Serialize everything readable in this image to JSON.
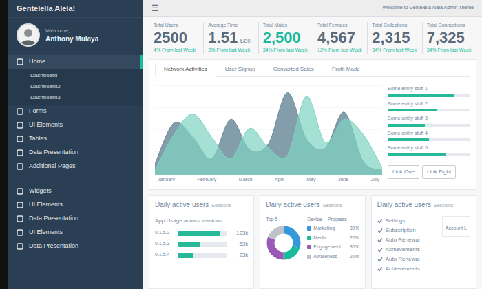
{
  "sidebar": {
    "brand": "Gentelella Alela!",
    "welcome": "Welcome,",
    "user": "Anthony Mulaya",
    "sections": [
      {
        "items": [
          {
            "label": "Home",
            "expanded": true,
            "selected": true,
            "children": [
              "Dashboard",
              "Dashboard2",
              "Dashboard3"
            ]
          },
          {
            "label": "Forms",
            "expanded": false,
            "selected": false,
            "children": []
          },
          {
            "label": "UI Elements",
            "expanded": false,
            "selected": false,
            "children": []
          },
          {
            "label": "Tables",
            "expanded": false,
            "selected": false,
            "children": []
          },
          {
            "label": "Data Presentation",
            "expanded": false,
            "selected": false,
            "children": []
          },
          {
            "label": "Additional Pages",
            "expanded": false,
            "selected": false,
            "children": []
          }
        ]
      },
      {
        "items": [
          {
            "label": "Widgets",
            "expanded": false,
            "selected": false,
            "children": []
          },
          {
            "label": "UI Elements",
            "expanded": false,
            "selected": false,
            "children": []
          },
          {
            "label": "Data Presentation",
            "expanded": false,
            "selected": false,
            "children": []
          },
          {
            "label": "UI Elements",
            "expanded": false,
            "selected": false,
            "children": []
          },
          {
            "label": "Data Presentation",
            "expanded": false,
            "selected": false,
            "children": []
          }
        ]
      }
    ]
  },
  "topbar": {
    "menu_icon": "☰",
    "notice": "Welcome to Gentelella Alela Admin Theme"
  },
  "stats": [
    {
      "label": "Total Users",
      "value": "2500",
      "change": "4% From last Week",
      "color": "#5A6A7A"
    },
    {
      "label": "Average Time",
      "value": "1.51",
      "unit": "Sec",
      "change": "3% From last Week",
      "color": "#5A6A7A"
    },
    {
      "label": "Total Males",
      "value": "2,500",
      "change": "34% From last Week",
      "color": "#1ABB9C"
    },
    {
      "label": "Total Females",
      "value": "4,567",
      "change": "12% From last Week",
      "color": "#5A6A7A"
    },
    {
      "label": "Total Collections",
      "value": "2,315",
      "change": "34% From last Week",
      "color": "#5A6A7A"
    },
    {
      "label": "Total Connections",
      "value": "7,325",
      "change": "34% From last Week",
      "color": "#5A6A7A"
    }
  ],
  "tabs": [
    {
      "label": "Network Activities",
      "selected": true
    },
    {
      "label": "User Signup",
      "selected": false
    },
    {
      "label": "Converted Sales",
      "selected": false
    },
    {
      "label": "Profit Made",
      "selected": false
    }
  ],
  "chart": {
    "x_labels": [
      "January",
      "February",
      "March",
      "April",
      "May",
      "June",
      "July"
    ],
    "series": [
      {
        "values": [
          12,
          58,
          42,
          18,
          62,
          28,
          35,
          92,
          40,
          30,
          70,
          15,
          5
        ],
        "color": "#6F8C9B"
      },
      {
        "values": [
          5,
          45,
          68,
          42,
          18,
          52,
          30,
          22,
          88,
          36,
          62,
          45,
          8
        ],
        "color": "#7ED3C1"
      }
    ]
  },
  "progress": [
    {
      "label": "Some entity stuff 1",
      "level": 0.8
    },
    {
      "label": "Some entity stuff 2",
      "level": 0.6
    },
    {
      "label": "Some entity stuff 3",
      "level": 0.45
    },
    {
      "label": "Some entity stuff 4",
      "level": 0.5
    },
    {
      "label": "Some entity stuff 5",
      "level": 0.7
    }
  ],
  "chart_buttons": [
    "Link One",
    "Link Eight"
  ],
  "sessions_card": {
    "title": "Daily active users",
    "subtitle": "Sessions",
    "heading": "App Usage across versions",
    "rows": [
      {
        "label": "0.1.5.2",
        "level": 0.85,
        "value": "123k"
      },
      {
        "label": "0.1.5.3",
        "level": 0.45,
        "value": "53k"
      },
      {
        "label": "0.1.5.4",
        "level": 0.3,
        "value": "23k"
      }
    ]
  },
  "devices_card": {
    "title": "Daily active users",
    "subtitle": "Sessions",
    "headers": [
      "Top 5",
      "Device",
      "Progress"
    ],
    "legend": [
      {
        "label": "Marketing",
        "value": "30%",
        "share": 30,
        "color": "#3498DB"
      },
      {
        "label": "Media",
        "value": "20%",
        "share": 20,
        "color": "#1ABB9C"
      },
      {
        "label": "Engagement",
        "value": "30%",
        "share": 30,
        "color": "#9B59B6"
      },
      {
        "label": "Awareness",
        "value": "20%",
        "share": 20,
        "color": "#BDC3C7"
      }
    ]
  },
  "settings_card": {
    "title": "Daily active users",
    "subtitle": "Sessions",
    "side_label": "Account L",
    "items": [
      {
        "label": "Settings",
        "checked": true
      },
      {
        "label": "Subscription",
        "checked": true
      },
      {
        "label": "Auto Renewal",
        "checked": true
      },
      {
        "label": "Achievements",
        "checked": true
      },
      {
        "label": "Auto Renewal",
        "checked": true
      },
      {
        "label": "Achievements",
        "checked": true
      }
    ]
  }
}
